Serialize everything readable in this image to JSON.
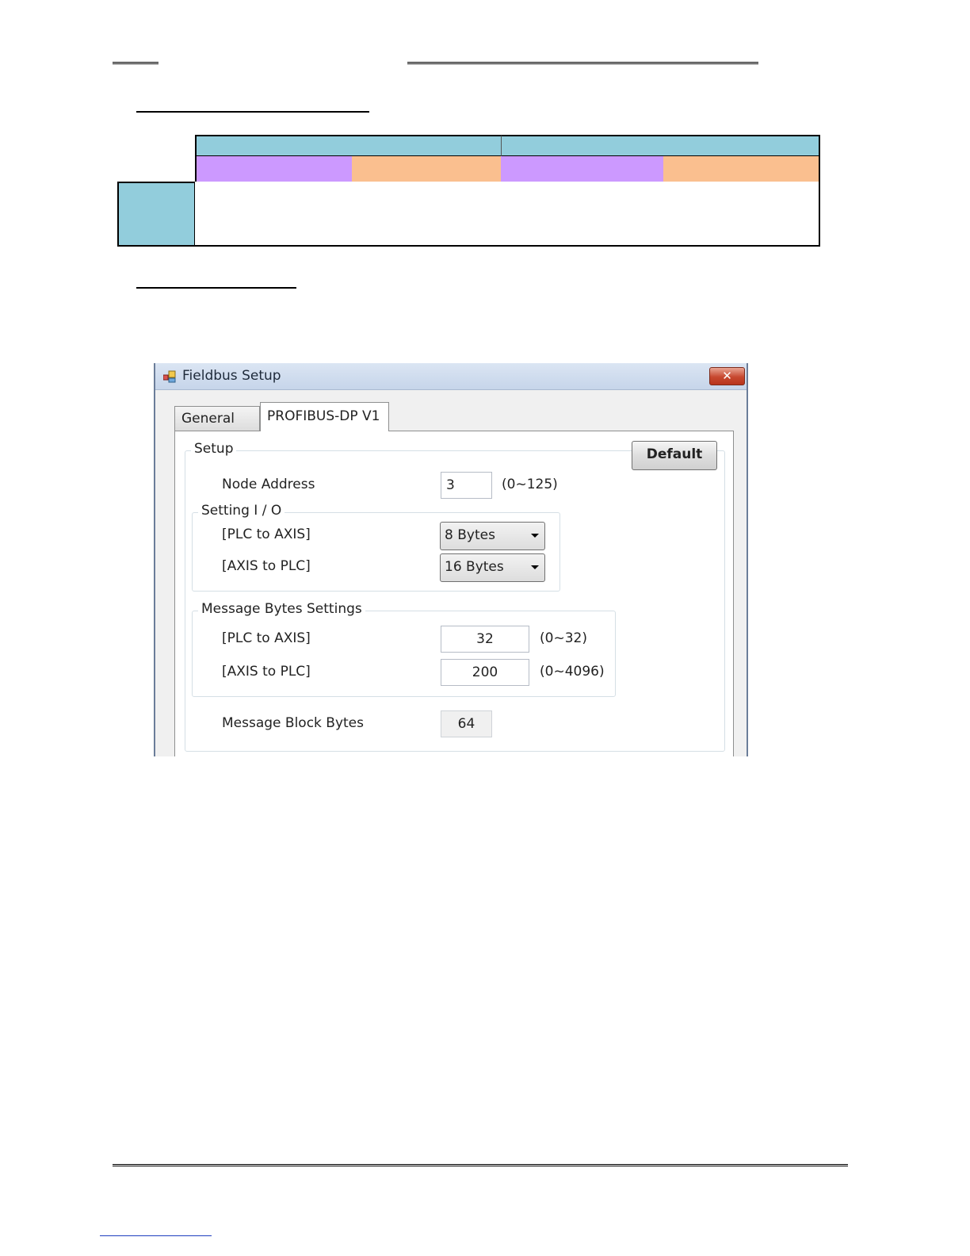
{
  "window": {
    "title": "Fieldbus Setup",
    "close_glyph": "✕",
    "title_icon": "app-window-icon"
  },
  "tabs": [
    {
      "label": "General",
      "active": false
    },
    {
      "label": "PROFIBUS-DP V1",
      "active": true
    }
  ],
  "setup": {
    "group_label": "Setup",
    "default_button": "Default",
    "node_address": {
      "label": "Node Address",
      "value": "3",
      "range": "(0~125)"
    }
  },
  "setting_io": {
    "group_label": "Setting I / O",
    "plc_to_axis": {
      "label": "[PLC to AXIS]",
      "selected": "8 Bytes"
    },
    "axis_to_plc": {
      "label": "[AXIS to PLC]",
      "selected": "16 Bytes"
    }
  },
  "message_bytes": {
    "group_label": "Message Bytes Settings",
    "plc_to_axis": {
      "label": "[PLC to AXIS]",
      "value": "32",
      "range": "(0~32)"
    },
    "axis_to_plc": {
      "label": "[AXIS to PLC]",
      "value": "200",
      "range": "(0~4096)"
    }
  },
  "message_block": {
    "label": "Message Block Bytes",
    "value": "64"
  },
  "colors": {
    "table_header_teal": "#92cddc",
    "table_purple": "#cc99ff",
    "table_orange": "#fabf8f",
    "close_button_red": "#c7482f"
  }
}
